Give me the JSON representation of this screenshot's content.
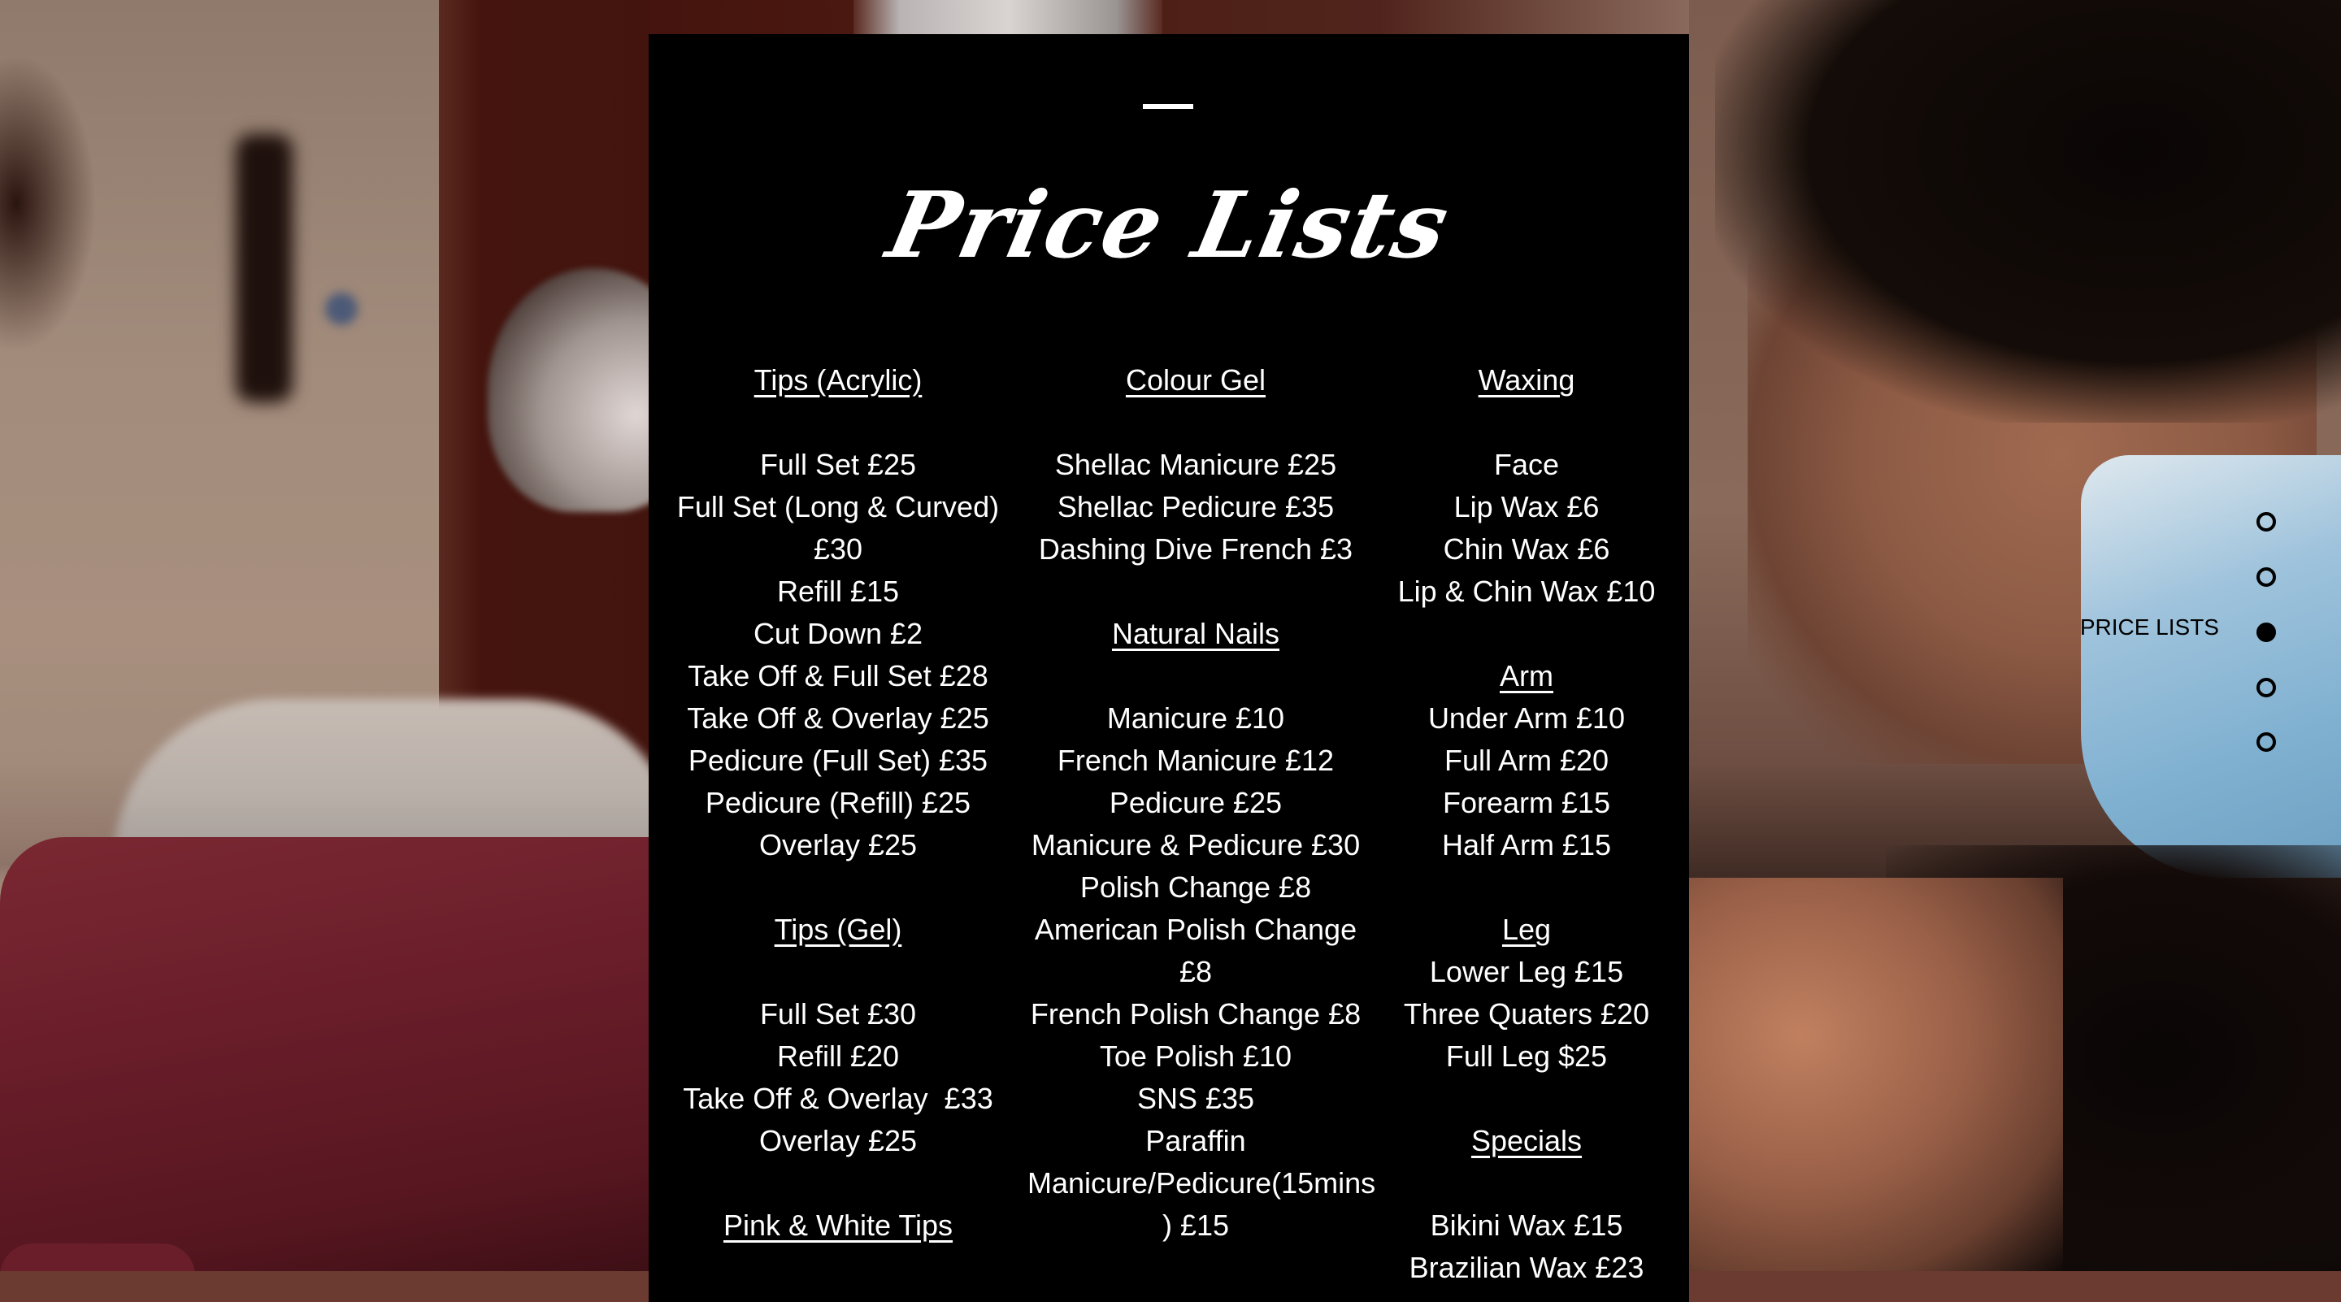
{
  "page": {
    "title": "Price Lists"
  },
  "colors": {
    "panel_background": "#000000",
    "panel_text": "#ffffff",
    "nav_color": "#000000"
  },
  "columns": [
    {
      "lines": [
        {
          "type": "heading",
          "text": "Tips (Acrylic)"
        },
        {
          "type": "blank",
          "text": ""
        },
        {
          "type": "item",
          "text": "Full Set £25"
        },
        {
          "type": "item",
          "text": "Full Set (Long & Curved)"
        },
        {
          "type": "item",
          "text": "£30"
        },
        {
          "type": "item",
          "text": "Refill £15"
        },
        {
          "type": "item",
          "text": "Cut Down £2"
        },
        {
          "type": "item",
          "text": "Take Off & Full Set £28"
        },
        {
          "type": "item",
          "text": "Take Off & Overlay £25"
        },
        {
          "type": "item",
          "text": "Pedicure (Full Set) £35"
        },
        {
          "type": "item",
          "text": "Pedicure (Refill) £25"
        },
        {
          "type": "item",
          "text": "Overlay £25"
        },
        {
          "type": "blank",
          "text": ""
        },
        {
          "type": "heading",
          "text": "Tips (Gel)"
        },
        {
          "type": "blank",
          "text": ""
        },
        {
          "type": "item",
          "text": "Full Set £30"
        },
        {
          "type": "item",
          "text": "Refill £20"
        },
        {
          "type": "item",
          "text": "Take Off & Overlay  £33"
        },
        {
          "type": "item",
          "text": "Overlay £25"
        },
        {
          "type": "blank",
          "text": ""
        },
        {
          "type": "heading",
          "text": "Pink & White Tips"
        }
      ]
    },
    {
      "lines": [
        {
          "type": "heading",
          "text": "Colour Gel"
        },
        {
          "type": "blank",
          "text": ""
        },
        {
          "type": "item",
          "text": "Shellac Manicure £25"
        },
        {
          "type": "item",
          "text": "Shellac Pedicure £35"
        },
        {
          "type": "item",
          "text": "Dashing Dive French £3"
        },
        {
          "type": "blank",
          "text": ""
        },
        {
          "type": "heading",
          "text": "Natural Nails"
        },
        {
          "type": "blank",
          "text": ""
        },
        {
          "type": "item",
          "text": "Manicure £10"
        },
        {
          "type": "item",
          "text": "French Manicure £12"
        },
        {
          "type": "item",
          "text": "Pedicure £25"
        },
        {
          "type": "item",
          "text": "Manicure & Pedicure £30"
        },
        {
          "type": "item",
          "text": "Polish Change £8"
        },
        {
          "type": "item",
          "text": "American Polish Change"
        },
        {
          "type": "item",
          "text": "£8"
        },
        {
          "type": "item",
          "text": "French Polish Change £8"
        },
        {
          "type": "item",
          "text": "Toe Polish £10"
        },
        {
          "type": "item",
          "text": "SNS £35"
        },
        {
          "type": "item",
          "text": "Paraffin"
        },
        {
          "type": "item",
          "text": "Manicure/Pedicure(15mins"
        },
        {
          "type": "item",
          "text": ") £15"
        }
      ]
    },
    {
      "lines": [
        {
          "type": "heading",
          "text": "Waxing"
        },
        {
          "type": "blank",
          "text": ""
        },
        {
          "type": "item",
          "text": "Face"
        },
        {
          "type": "item",
          "text": "Lip Wax £6"
        },
        {
          "type": "item",
          "text": "Chin Wax £6"
        },
        {
          "type": "item",
          "text": "Lip & Chin Wax £10"
        },
        {
          "type": "blank",
          "text": ""
        },
        {
          "type": "heading",
          "text": "Arm"
        },
        {
          "type": "item",
          "text": "Under Arm £10"
        },
        {
          "type": "item",
          "text": "Full Arm £20"
        },
        {
          "type": "item",
          "text": "Forearm £15"
        },
        {
          "type": "item",
          "text": "Half Arm £15"
        },
        {
          "type": "blank",
          "text": ""
        },
        {
          "type": "heading",
          "text": "Leg"
        },
        {
          "type": "item",
          "text": "Lower Leg £15"
        },
        {
          "type": "item",
          "text": "Three Quaters £20"
        },
        {
          "type": "item",
          "text": "Full Leg $25"
        },
        {
          "type": "blank",
          "text": ""
        },
        {
          "type": "heading",
          "text": "Specials"
        },
        {
          "type": "blank",
          "text": ""
        },
        {
          "type": "item",
          "text": "Bikini Wax £15"
        },
        {
          "type": "item",
          "text": "Brazilian Wax £23"
        }
      ]
    }
  ],
  "side_nav": {
    "active_label": "PRICE LISTS",
    "active_index": 2,
    "dots": [
      {
        "name": "section-1",
        "active": false
      },
      {
        "name": "section-2",
        "active": false
      },
      {
        "name": "price-lists",
        "active": true
      },
      {
        "name": "section-4",
        "active": false
      },
      {
        "name": "section-5",
        "active": false
      }
    ]
  }
}
